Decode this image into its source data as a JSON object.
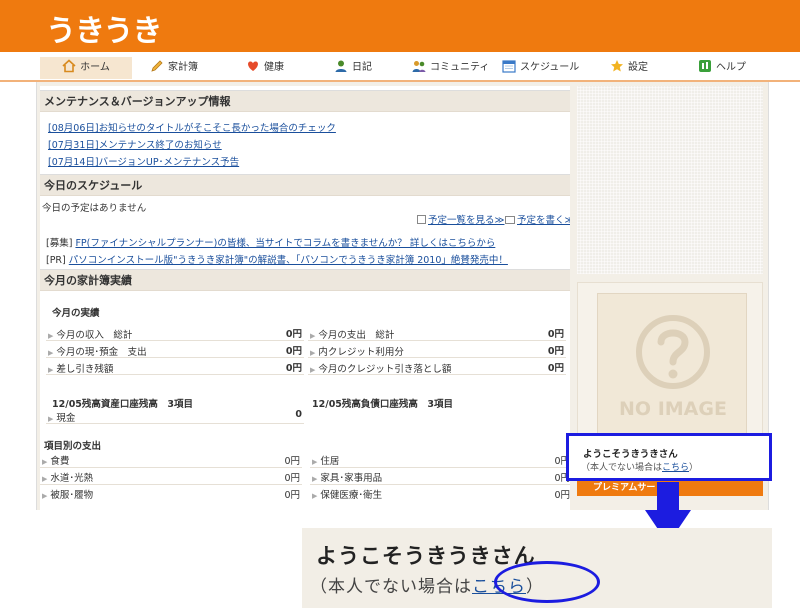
{
  "header": {
    "logo": "うきうき"
  },
  "nav": {
    "items": [
      {
        "label": "ホーム"
      },
      {
        "label": "家計簿"
      },
      {
        "label": "健康"
      },
      {
        "label": "日記"
      },
      {
        "label": "コミュニティ"
      },
      {
        "label": "スケジュール"
      },
      {
        "label": "設定"
      },
      {
        "label": "ヘルプ"
      }
    ]
  },
  "maintenance": {
    "title": "メンテナンス＆バージョンアップ情報",
    "links": [
      "[08月06日]お知らせのタイトルがそこそこ長かった場合のチェック",
      "[07月31日]メンテナンス終了のお知らせ",
      "[07月14日]バージョンUP･メンテナンス予告"
    ]
  },
  "schedule": {
    "title": "今日のスケジュール",
    "empty": "今日の予定はありません",
    "view_all": "予定一覧を見る≫",
    "write": "予定を書く≫",
    "promo1_tag": "[募集]",
    "promo1_link": "FP(ファイナンシャルプランナー)の皆様、当サイトでコラムを書きませんか？ 詳しくはこちらから",
    "promo2_tag": "[PR]",
    "promo2_link": "パソコンインストール版\"うきうき家計簿\"の解説書、「パソコンでうきうき家計簿 2010」絶賛発売中！"
  },
  "household": {
    "title": "今月の家計簿実績",
    "results_title": "今月の実績",
    "left": [
      {
        "label": "今月の収入　総計",
        "value": "0円"
      },
      {
        "label": "今月の現･預金　支出",
        "value": "0円"
      },
      {
        "label": "差し引き残額",
        "value": "0円"
      }
    ],
    "right": [
      {
        "label": "今月の支出　総計",
        "value": "0円"
      },
      {
        "label": "内クレジット利用分",
        "value": "0円"
      },
      {
        "label": "今月のクレジット引き落とし額",
        "value": "0円"
      }
    ],
    "asset_title": "12/05残高資産口座残高　3項目",
    "asset_rows": [
      {
        "label": "現金",
        "value": "0"
      }
    ],
    "debt_title": "12/05残高負債口座残高　3項目",
    "expense_title": "項目別の支出",
    "expense_left": [
      {
        "label": "食費",
        "value": "0円"
      },
      {
        "label": "水道･光熱",
        "value": "0円"
      },
      {
        "label": "被服･履物",
        "value": "0円"
      }
    ],
    "expense_right": [
      {
        "label": "住居",
        "value": "0円"
      },
      {
        "label": "家具･家事用品",
        "value": "0円"
      },
      {
        "label": "保健医療･衛生",
        "value": "0円"
      }
    ]
  },
  "sidebar": {
    "no_image": "NO IMAGE",
    "premium": "プレミアムサー"
  },
  "welcome": {
    "title": "ようこそうきうきさん",
    "sub_prefix": "（本人でない場合は",
    "sub_link": "こちら",
    "sub_suffix": "）"
  },
  "zoom": {
    "title": "ようこそうきうきさん",
    "sub_prefix": "（本人でない場合は",
    "sub_link": "こちら",
    "sub_suffix": "）"
  },
  "colors": {
    "brand": "#ef7a0f",
    "highlight": "#1c1ce0",
    "link": "#1a4f9c"
  }
}
